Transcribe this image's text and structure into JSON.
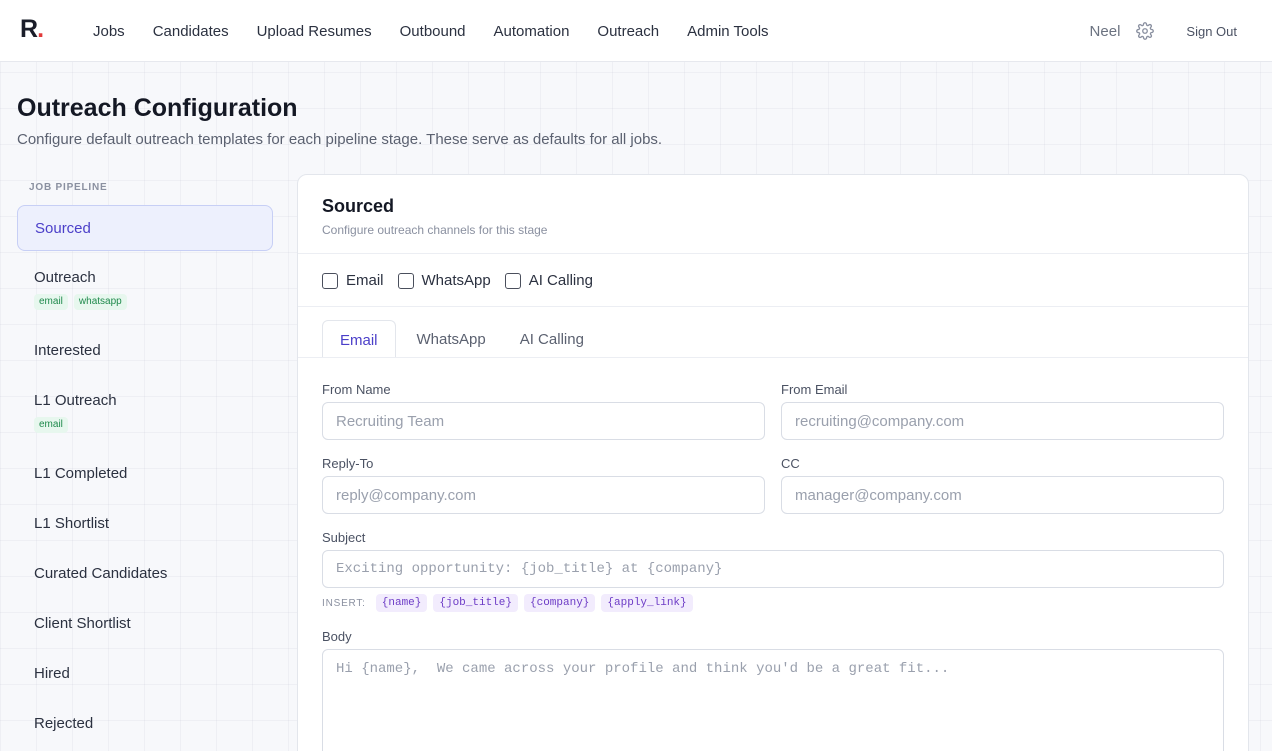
{
  "brand": {
    "logo_letter": "R",
    "logo_dot": "."
  },
  "nav": {
    "items": [
      "Jobs",
      "Candidates",
      "Upload Resumes",
      "Outbound",
      "Automation",
      "Outreach",
      "Admin Tools"
    ],
    "user": "Neel",
    "sign_out": "Sign Out"
  },
  "header": {
    "title": "Outreach Configuration",
    "subtitle": "Configure default outreach templates for each pipeline stage. These serve as defaults for all jobs."
  },
  "sidebar": {
    "label": "JOB PIPELINE",
    "stages": [
      {
        "name": "Sourced",
        "active": true,
        "channels": []
      },
      {
        "name": "Outreach",
        "active": false,
        "channels": [
          "email",
          "whatsapp"
        ]
      },
      {
        "name": "Interested",
        "active": false,
        "channels": []
      },
      {
        "name": "L1 Outreach",
        "active": false,
        "channels": [
          "email"
        ]
      },
      {
        "name": "L1 Completed",
        "active": false,
        "channels": []
      },
      {
        "name": "L1 Shortlist",
        "active": false,
        "channels": []
      },
      {
        "name": "Curated Candidates",
        "active": false,
        "channels": []
      },
      {
        "name": "Client Shortlist",
        "active": false,
        "channels": []
      },
      {
        "name": "Hired",
        "active": false,
        "channels": []
      },
      {
        "name": "Rejected",
        "active": false,
        "channels": []
      }
    ]
  },
  "stage_panel": {
    "title": "Sourced",
    "subtitle": "Configure outreach channels for this stage",
    "channels": [
      {
        "label": "Email",
        "checked": false
      },
      {
        "label": "WhatsApp",
        "checked": false
      },
      {
        "label": "AI Calling",
        "checked": false
      }
    ],
    "tabs": [
      {
        "label": "Email",
        "active": true
      },
      {
        "label": "WhatsApp",
        "active": false
      },
      {
        "label": "AI Calling",
        "active": false
      }
    ],
    "form": {
      "from_name": {
        "label": "From Name",
        "placeholder": "Recruiting Team",
        "value": ""
      },
      "from_email": {
        "label": "From Email",
        "placeholder": "recruiting@company.com",
        "value": ""
      },
      "reply_to": {
        "label": "Reply-To",
        "placeholder": "reply@company.com",
        "value": ""
      },
      "cc": {
        "label": "CC",
        "placeholder": "manager@company.com",
        "value": ""
      },
      "subject": {
        "label": "Subject",
        "placeholder": "Exciting opportunity: {job_title} at {company}",
        "value": ""
      },
      "insert_label": "INSERT:",
      "tokens": [
        "{name}",
        "{job_title}",
        "{company}",
        "{apply_link}"
      ],
      "body": {
        "label": "Body",
        "placeholder": "Hi {name},  We came across your profile and think you'd be a great fit...",
        "value": ""
      }
    }
  },
  "colors": {
    "accent": "#4b3fc9",
    "logo_dot": "#e23b3b",
    "chip_green": "#1f8a4c",
    "token_purple": "#6d3cc6"
  }
}
